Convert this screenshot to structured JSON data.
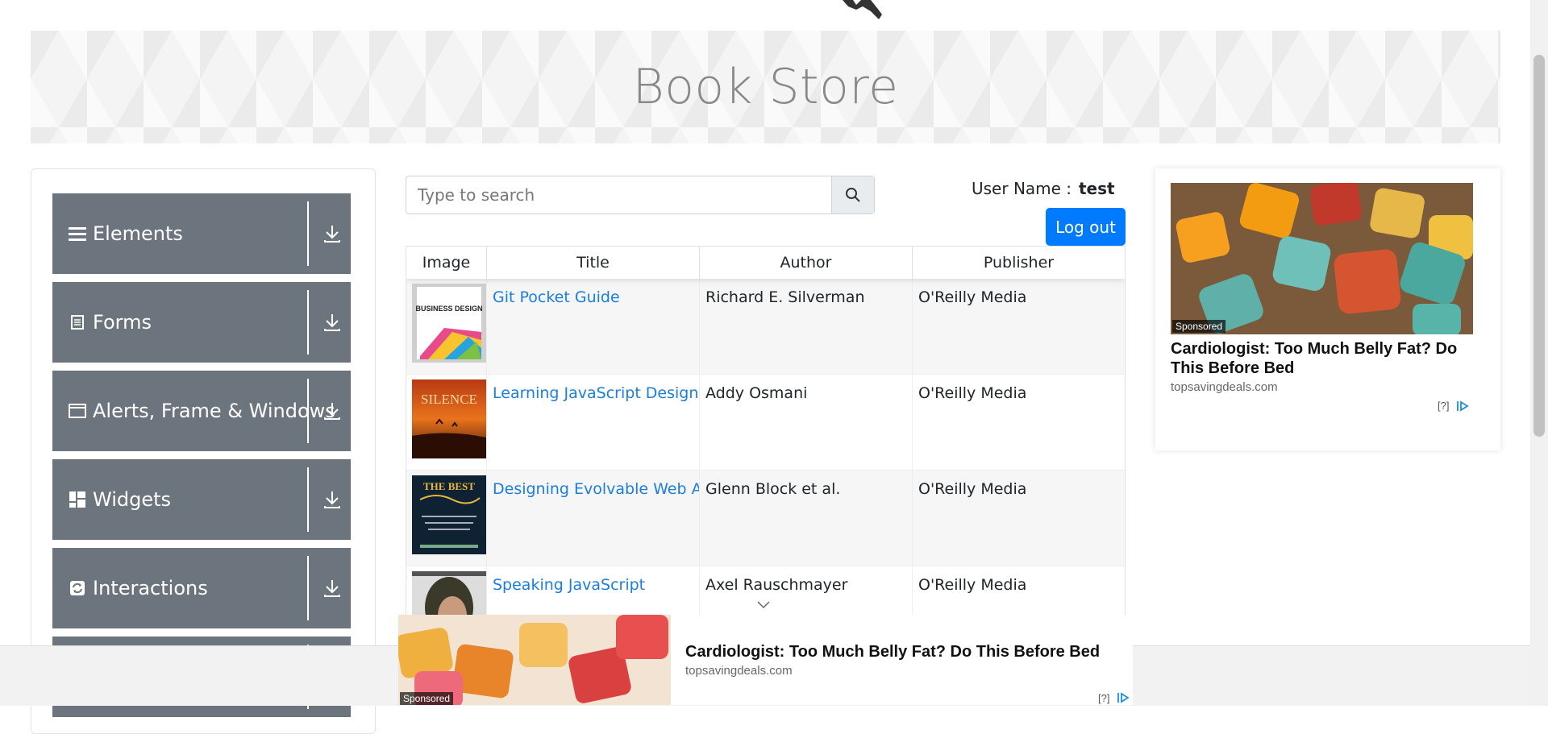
{
  "banner": {
    "title": "Book Store"
  },
  "sidebar": {
    "groups": [
      {
        "label": "Elements",
        "icon": "hamburger-icon"
      },
      {
        "label": "Forms",
        "icon": "document-icon"
      },
      {
        "label": "Alerts, Frame & Windows",
        "icon": "window-icon"
      },
      {
        "label": "Widgets",
        "icon": "widgets-icon"
      },
      {
        "label": "Interactions",
        "icon": "refresh-icon"
      }
    ]
  },
  "search": {
    "placeholder": "Type to search",
    "value": ""
  },
  "user": {
    "label": "User Name :",
    "value": "test",
    "logout_label": "Log out"
  },
  "table": {
    "headers": [
      "Image",
      "Title",
      "Author",
      "Publisher"
    ],
    "rows": [
      {
        "title": "Git Pocket Guide",
        "author": "Richard E. Silverman",
        "publisher": "O'Reilly Media",
        "cover_text": "BUSINESS DESIGN"
      },
      {
        "title": "Learning JavaScript Design Patterns",
        "author": "Addy Osmani",
        "publisher": "O'Reilly Media",
        "cover_text": "SILENCE"
      },
      {
        "title": "Designing Evolvable Web APIs with ASP.NET",
        "author": "Glenn Block et al.",
        "publisher": "O'Reilly Media",
        "cover_text": "THE BEST"
      },
      {
        "title": "Speaking JavaScript",
        "author": "Axel Rauschmayer",
        "publisher": "O'Reilly Media",
        "cover_text": ""
      }
    ]
  },
  "ad_right": {
    "sponsored": "Sponsored",
    "headline": "Cardiologist: Too Much Belly Fat? Do This Before Bed",
    "domain": "topsavingdeals.com",
    "info": "[?]"
  },
  "ad_bottom": {
    "sponsored": "Sponsored",
    "headline": "Cardiologist: Too Much Belly Fat? Do This Before Bed",
    "domain": "topsavingdeals.com",
    "info": "[?]"
  },
  "colors": {
    "sidebar_header": "#6c757d",
    "primary": "#007bff",
    "link": "#1a7ee0"
  }
}
